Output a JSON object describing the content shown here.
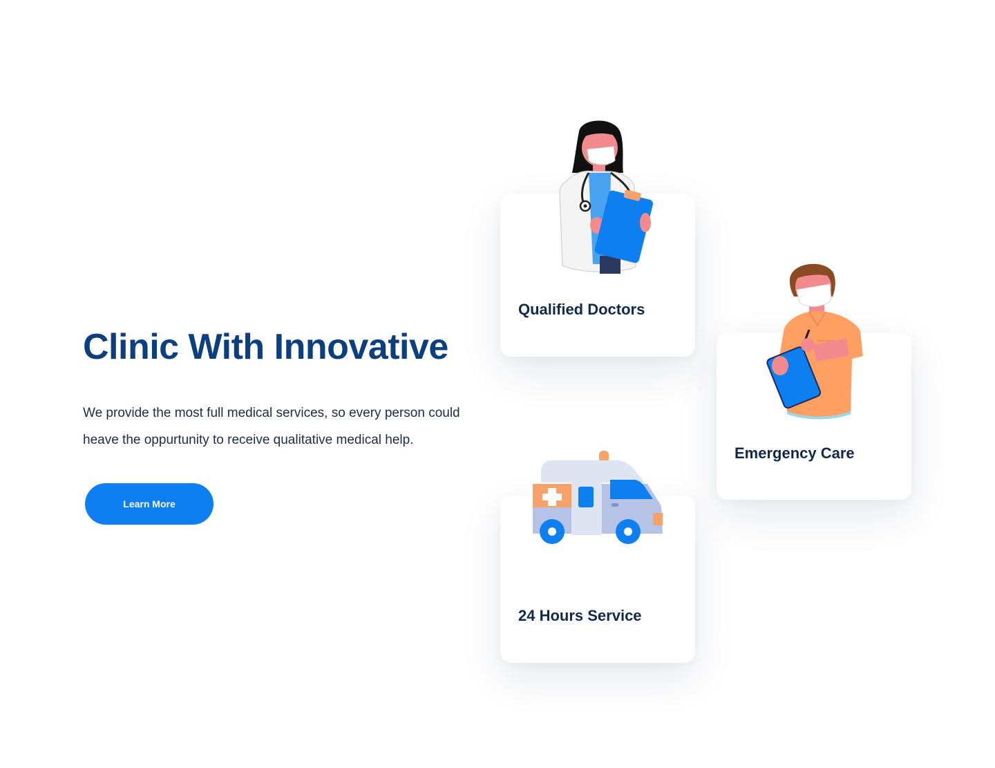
{
  "hero": {
    "title": "Clinic With Innovative",
    "description": "We provide the most full medical services, so every person could heave the oppurtunity to receive qualitative medical help.",
    "button_label": "Learn More"
  },
  "features": [
    {
      "title": "Qualified Doctors",
      "icon": "doctor-illustration"
    },
    {
      "title": "Emergency Care",
      "icon": "nurse-illustration"
    },
    {
      "title": "24 Hours Service",
      "icon": "ambulance-illustration"
    }
  ],
  "colors": {
    "primary": "#0e7ff0",
    "heading": "#0c3f7d",
    "text": "#1c2b46",
    "accent_orange": "#f7a26a",
    "skin": "#f28a8e"
  }
}
